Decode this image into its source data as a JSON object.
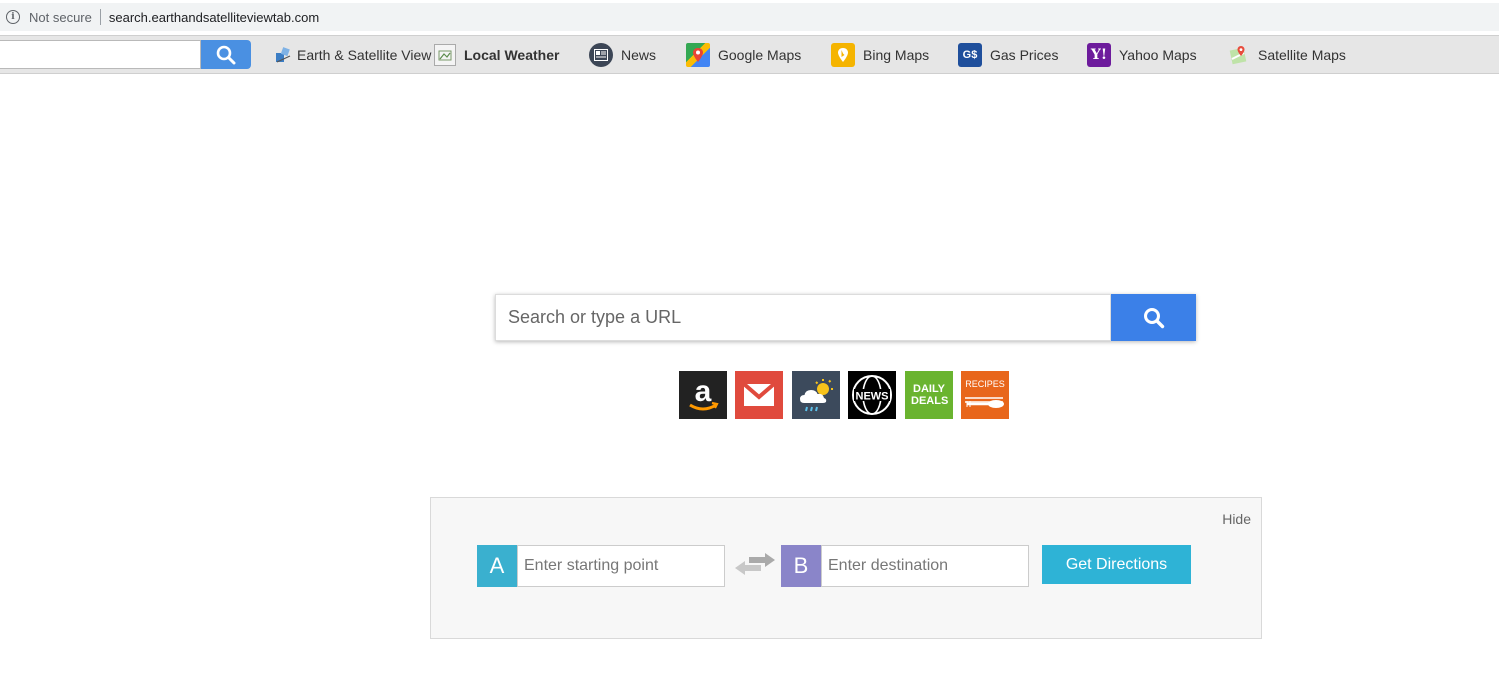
{
  "addressbar": {
    "security_label": "Not secure",
    "url": "search.earthandsatelliteviewtab.com"
  },
  "toolbar": {
    "search_value": "",
    "links": [
      {
        "label": "Earth & Satellite View",
        "icon": "earth-satellite-icon",
        "bold": false
      },
      {
        "label": "Local Weather",
        "icon": "broken-image-icon",
        "bold": true
      },
      {
        "label": "News",
        "icon": "news-icon",
        "bold": false
      },
      {
        "label": "Google Maps",
        "icon": "google-maps-icon",
        "bold": false
      },
      {
        "label": "Bing Maps",
        "icon": "bing-maps-icon",
        "bold": false
      },
      {
        "label": "Gas Prices",
        "icon": "gas-prices-icon",
        "bold": false
      },
      {
        "label": "Yahoo Maps",
        "icon": "yahoo-icon",
        "bold": false
      },
      {
        "label": "Satellite Maps",
        "icon": "satellite-maps-icon",
        "bold": false
      }
    ]
  },
  "search": {
    "placeholder": "Search or type a URL",
    "value": ""
  },
  "shortcuts": [
    {
      "name": "amazon",
      "icon": "amazon-icon",
      "text": "a",
      "color": "#222222"
    },
    {
      "name": "gmail",
      "icon": "gmail-icon",
      "text": "",
      "color": "#e04a3d"
    },
    {
      "name": "weather",
      "icon": "weather-icon",
      "text": "",
      "color": "#3c4a5c"
    },
    {
      "name": "news",
      "icon": "globe-news-icon",
      "text": "NEWS",
      "color": "#000000"
    },
    {
      "name": "daily-deals",
      "icon": "daily-deals-icon",
      "text": "DAILY DEALS",
      "color": "#6ab42f"
    },
    {
      "name": "recipes",
      "icon": "recipes-icon",
      "text": "RECIPES",
      "color": "#e8661b"
    }
  ],
  "directions": {
    "hide_label": "Hide",
    "start_letter": "A",
    "start_placeholder": "Enter starting point",
    "dest_letter": "B",
    "dest_placeholder": "Enter destination",
    "button_label": "Get Directions",
    "colors": {
      "a": "#3ab0cf",
      "b": "#8a85c9",
      "button": "#2eb3d6"
    }
  }
}
